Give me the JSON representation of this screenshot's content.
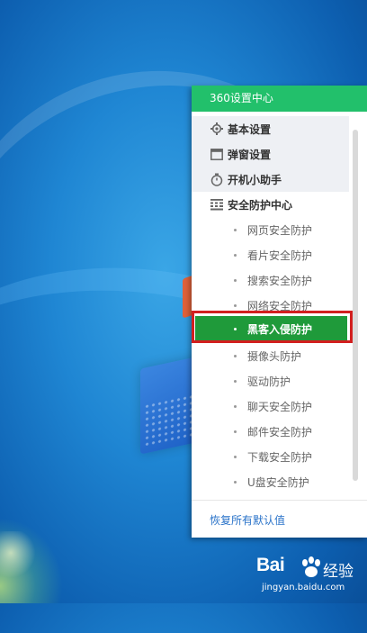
{
  "panel": {
    "title": "360设置中心",
    "top_items": [
      {
        "label": "基本设置",
        "icon": "gear-icon"
      },
      {
        "label": "弹窗设置",
        "icon": "window-icon"
      },
      {
        "label": "开机小助手",
        "icon": "stopwatch-icon"
      },
      {
        "label": "安全防护中心",
        "icon": "grid-icon"
      }
    ],
    "sub_items": [
      "网页安全防护",
      "看片安全防护",
      "搜索安全防护",
      "网络安全防护",
      "黑客入侵防护",
      "摄像头防护",
      "驱动防护",
      "聊天安全防护",
      "邮件安全防护",
      "下载安全防护",
      "U盘安全防护"
    ],
    "active_item": "黑客入侵防护",
    "footer_link": "恢复所有默认值"
  },
  "watermark": {
    "brand": "Bai",
    "brand_suffix": "经验",
    "url": "jingyan.baidu.com"
  },
  "colors": {
    "header_green": "#22c06b",
    "active_green": "#1f9a3a",
    "highlight_red": "#d21f1f",
    "link_blue": "#2a73c9"
  }
}
